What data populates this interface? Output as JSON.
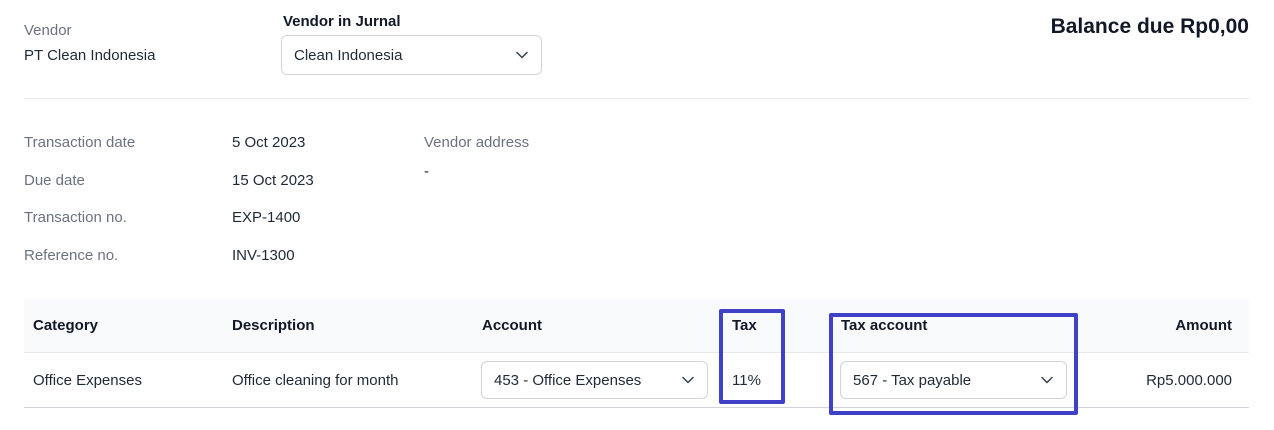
{
  "vendor": {
    "label": "Vendor",
    "value": "PT Clean Indonesia"
  },
  "vendor_in_jurnal": {
    "label": "Vendor in Jurnal",
    "selected": "Clean Indonesia"
  },
  "balance_due": "Balance due Rp0,00",
  "details": {
    "transaction_date": {
      "label": "Transaction date",
      "value": "5 Oct 2023"
    },
    "due_date": {
      "label": "Due date",
      "value": "15 Oct 2023"
    },
    "transaction_no": {
      "label": "Transaction no.",
      "value": "EXP-1400"
    },
    "reference_no": {
      "label": "Reference no.",
      "value": "INV-1300"
    },
    "vendor_address": {
      "label": "Vendor address",
      "value": "-"
    }
  },
  "table": {
    "columns": [
      "Category",
      "Description",
      "Account",
      "Tax",
      "Tax account",
      "Amount"
    ],
    "rows": [
      {
        "category": "Office Expenses",
        "description": "Office cleaning for month",
        "account": "453 - Office Expenses",
        "tax": "11%",
        "tax_account": "567 - Tax payable",
        "amount": "Rp5.000.000"
      }
    ]
  },
  "icons": {
    "dropdown": "chevron-down-icon"
  },
  "colors": {
    "highlight": "#3f41c7"
  }
}
